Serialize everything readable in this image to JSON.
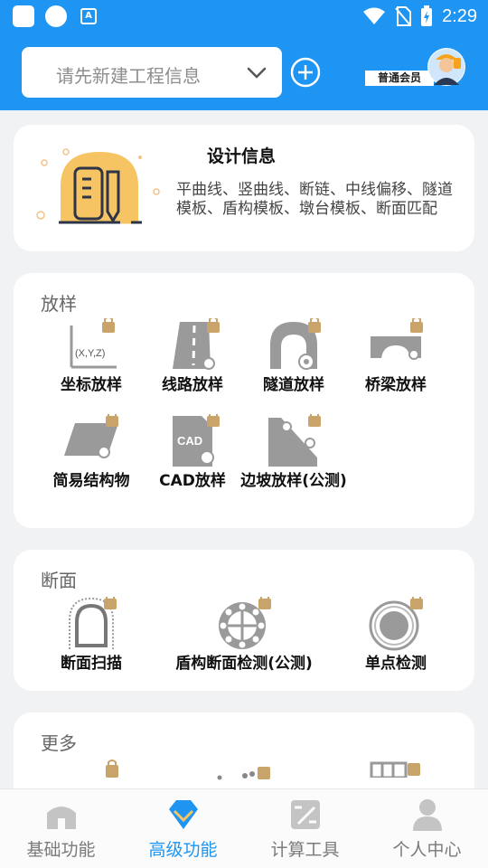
{
  "status_bar": {
    "time": "2:29",
    "app_badge": "A"
  },
  "header": {
    "project_placeholder": "请先新建工程信息",
    "member_label": "普通会员",
    "accent": "#1e95f2"
  },
  "design": {
    "title": "设计信息",
    "description": "平曲线、竖曲线、断链、中线偏移、隧道模板、盾构模板、墩台模板、断面匹配"
  },
  "fangyang": {
    "title": "放样",
    "items": [
      {
        "label": "坐标放样",
        "icon": "coordinate-icon",
        "icon_text": "(X,Y,Z)"
      },
      {
        "label": "线路放样",
        "icon": "road-icon"
      },
      {
        "label": "隧道放样",
        "icon": "tunnel-icon"
      },
      {
        "label": "桥梁放样",
        "icon": "bridge-icon"
      },
      {
        "label": "简易结构物",
        "icon": "structure-icon"
      },
      {
        "label": "CAD放样",
        "icon": "cad-file-icon",
        "icon_text": "CAD"
      },
      {
        "label": "边坡放样(公测)",
        "icon": "slope-icon"
      }
    ]
  },
  "duanmian": {
    "title": "断面",
    "items": [
      {
        "label": "断面扫描",
        "icon": "section-scan-icon"
      },
      {
        "label": "盾构断面检测(公测)",
        "icon": "shield-section-icon"
      },
      {
        "label": "单点检测",
        "icon": "single-point-icon"
      }
    ]
  },
  "gengduo": {
    "title": "更多"
  },
  "nav": [
    {
      "label": "基础功能",
      "icon": "home-icon",
      "active": false
    },
    {
      "label": "高级功能",
      "icon": "diamond-icon",
      "active": true
    },
    {
      "label": "计算工具",
      "icon": "calculator-icon",
      "active": false
    },
    {
      "label": "个人中心",
      "icon": "person-icon",
      "active": false
    }
  ]
}
